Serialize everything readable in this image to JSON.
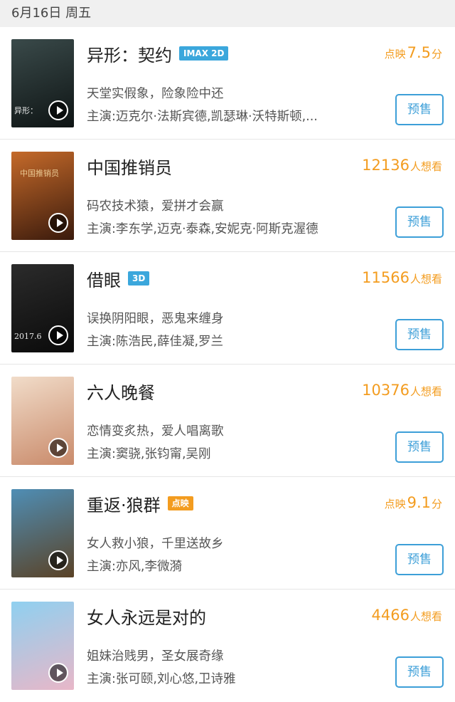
{
  "header": {
    "date": "6月16日 周五"
  },
  "movies": [
    {
      "title": "异形：契约",
      "tag": "IMAX 2D",
      "tag_color": "#3ba7dc",
      "score_label": "点映",
      "score_value": "7.5",
      "score_suffix": "分",
      "desc": "天堂实假象，险象险中还",
      "cast": "主演:迈克尔·法斯宾德,凯瑟琳·沃特斯顿,...",
      "button": "预售",
      "poster_caption": "异形：",
      "poster_colors": [
        "#3a4a4a",
        "#0e1414"
      ]
    },
    {
      "title": "中国推销员",
      "tag": "",
      "score_label": "",
      "score_value": "12136",
      "score_suffix": "人想看",
      "desc": "码农技术猿，爱拼才会赢",
      "cast": "主演:李东学,迈克·泰森,安妮克·阿斯克渥德",
      "button": "预售",
      "poster_caption": "中国推销员",
      "poster_colors": [
        "#c56a2a",
        "#3a1a0c"
      ]
    },
    {
      "title": "借眼",
      "tag": "3D",
      "tag_color": "#3ba7dc",
      "score_label": "",
      "score_value": "11566",
      "score_suffix": "人想看",
      "desc": "误换阴阳眼，恶鬼来缠身",
      "cast": "主演:陈浩民,薛佳凝,罗兰",
      "button": "预售",
      "poster_caption": "2017.6",
      "poster_colors": [
        "#2b2b2b",
        "#0a0a0a"
      ]
    },
    {
      "title": "六人晚餐",
      "tag": "",
      "score_label": "",
      "score_value": "10376",
      "score_suffix": "人想看",
      "desc": "恋情变炙热，爱人唱离歌",
      "cast": "主演:窦骁,张钧甯,吴刚",
      "button": "预售",
      "poster_caption": "",
      "poster_colors": [
        "#f1dcc9",
        "#c98a6a"
      ]
    },
    {
      "title": "重返·狼群",
      "tag": "点映",
      "tag_color": "#f39c1f",
      "score_label": "点映",
      "score_value": "9.1",
      "score_suffix": "分",
      "desc": "女人救小狼，千里送故乡",
      "cast": "主演:亦风,李微漪",
      "button": "预售",
      "poster_caption": "",
      "poster_colors": [
        "#4f8eb5",
        "#5a4226"
      ]
    },
    {
      "title": "女人永远是对的",
      "tag": "",
      "score_label": "",
      "score_value": "4466",
      "score_suffix": "人想看",
      "desc": "姐妹治贱男，圣女展奇缘",
      "cast": "主演:张可颐,刘心悠,卫诗雅",
      "button": "预售",
      "poster_caption": "",
      "poster_colors": [
        "#8fd0f0",
        "#e8b7c8"
      ]
    }
  ]
}
